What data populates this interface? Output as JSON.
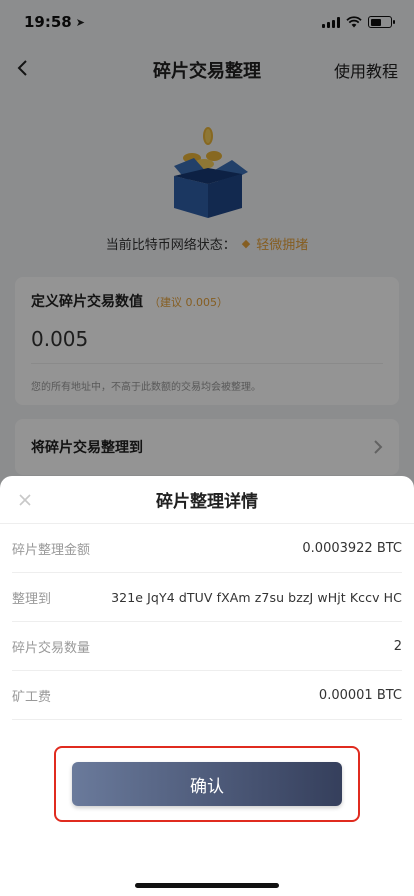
{
  "status_bar": {
    "time": "19:58",
    "location_icon": "location-arrow-icon"
  },
  "nav": {
    "back_icon": "chevron-left-icon",
    "title": "碎片交易整理",
    "right_label": "使用教程"
  },
  "hero": {
    "illustration": "box-with-coins-icon",
    "network_label": "当前比特币网络状态：",
    "network_value": "轻微拥堵",
    "network_color": "#e6a23c"
  },
  "define_card": {
    "title": "定义碎片交易数值",
    "hint": "（建议 0.005）",
    "amount": "0.005",
    "note": "您的所有地址中，不高于此数额的交易均会被整理。"
  },
  "target_card": {
    "title": "将碎片交易整理到"
  },
  "sheet": {
    "title": "碎片整理详情",
    "close_icon": "close-icon",
    "rows": [
      {
        "label": "碎片整理金额",
        "value": "0.0003922 BTC"
      },
      {
        "label": "整理到",
        "value": "321e JqY4 dTUV fXAm z7su bzzJ wHjt Kccv HC"
      },
      {
        "label": "碎片交易数量",
        "value": "2"
      },
      {
        "label": "矿工费",
        "value": "0.00001 BTC"
      }
    ],
    "confirm_label": "确认",
    "highlight_color": "#e02b1f"
  }
}
